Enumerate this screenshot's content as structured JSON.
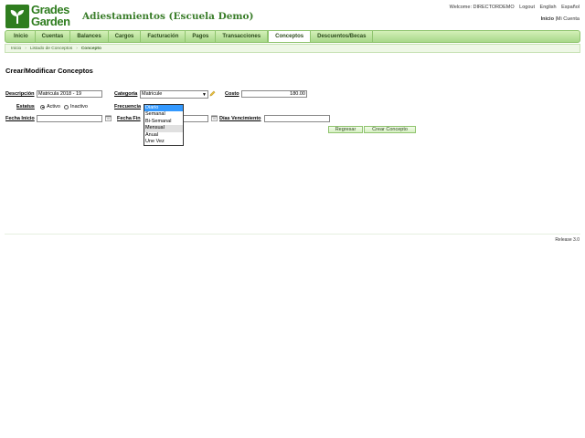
{
  "brand": {
    "logo_line1": "Grades",
    "logo_line2": "Garden",
    "app_title": "Adiestamientos (Escuela Demo)"
  },
  "top": {
    "welcome": "Welcome: DIRECTORDEMO",
    "logout": "Logout",
    "english": "English",
    "espanol": "Español",
    "inicio": "Inicio",
    "mi_cuenta": "Mi Cuenta"
  },
  "nav": [
    "Inicio",
    "Cuentas",
    "Balances",
    "Cargos",
    "Facturación",
    "Pagos",
    "Transacciones",
    "Conceptos",
    "Descuentos/Becas"
  ],
  "nav_active": "Conceptos",
  "breadcrumb": {
    "home": "Inicio",
    "list": "Listado de Conceptos",
    "current": "Concepto"
  },
  "page_title": "Crear/Modificar Conceptos",
  "form": {
    "descripcion_label": "Descripción",
    "descripcion_value": "Matricula 2018 - 19",
    "categoria_label": "Categoría",
    "categoria_value": "Matricule",
    "costo_label": "Costo",
    "costo_value": "180.00",
    "estatus_label": "Estatus",
    "activo": "Activo",
    "inactivo": "Inactivo",
    "estatus_selected": "Activo",
    "frecuencia_label": "Frecuencia",
    "frecuencia_options": [
      "Diario",
      "Semanal",
      "Bi-Semanal",
      "Mensual",
      "Anual",
      "Une Vez"
    ],
    "frecuencia_highlighted": "Diario",
    "frecuencia_selected": "Mensual",
    "fecha_inicio_label": "Fecha Inicio",
    "fecha_inicio_value": "",
    "fecha_fin_label": "Fecha Fin",
    "fecha_fin_value": "",
    "dias_label": "Días Vencimiento",
    "dias_value": ""
  },
  "buttons": {
    "regresar": "Regresar",
    "crear": "Crear Concepto"
  },
  "footer": {
    "release": "Release 3.0"
  },
  "colors": {
    "brand_green": "#2f7d1f",
    "nav_green": "#a8d88a",
    "highlight": "#3399ff"
  }
}
